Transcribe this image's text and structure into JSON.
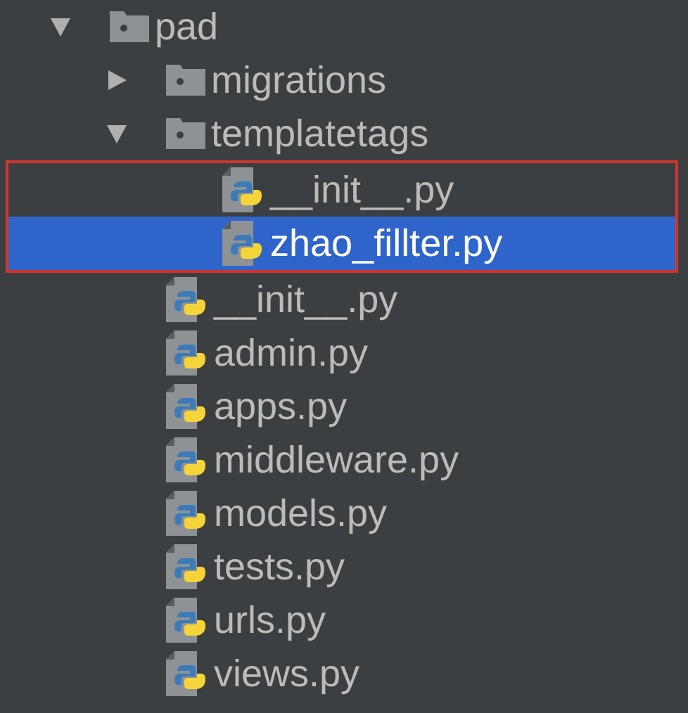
{
  "tree": [
    {
      "kind": "folder",
      "name": "pad",
      "expanded": true,
      "selected": false,
      "children": [
        {
          "kind": "folder",
          "name": "migrations",
          "expanded": false,
          "selected": false
        },
        {
          "kind": "folder",
          "name": "templatetags",
          "expanded": true,
          "selected": false,
          "children_framed": true,
          "children": [
            {
              "kind": "python",
              "name": "__init__.py",
              "selected": false
            },
            {
              "kind": "python",
              "name": "zhao_fillter.py",
              "selected": true
            }
          ]
        },
        {
          "kind": "python",
          "name": "__init__.py",
          "selected": false
        },
        {
          "kind": "python",
          "name": "admin.py",
          "selected": false
        },
        {
          "kind": "python",
          "name": "apps.py",
          "selected": false
        },
        {
          "kind": "python",
          "name": "middleware.py",
          "selected": false
        },
        {
          "kind": "python",
          "name": "models.py",
          "selected": false
        },
        {
          "kind": "python",
          "name": "tests.py",
          "selected": false
        },
        {
          "kind": "python",
          "name": "urls.py",
          "selected": false
        },
        {
          "kind": "python",
          "name": "views.py",
          "selected": false
        }
      ]
    }
  ]
}
